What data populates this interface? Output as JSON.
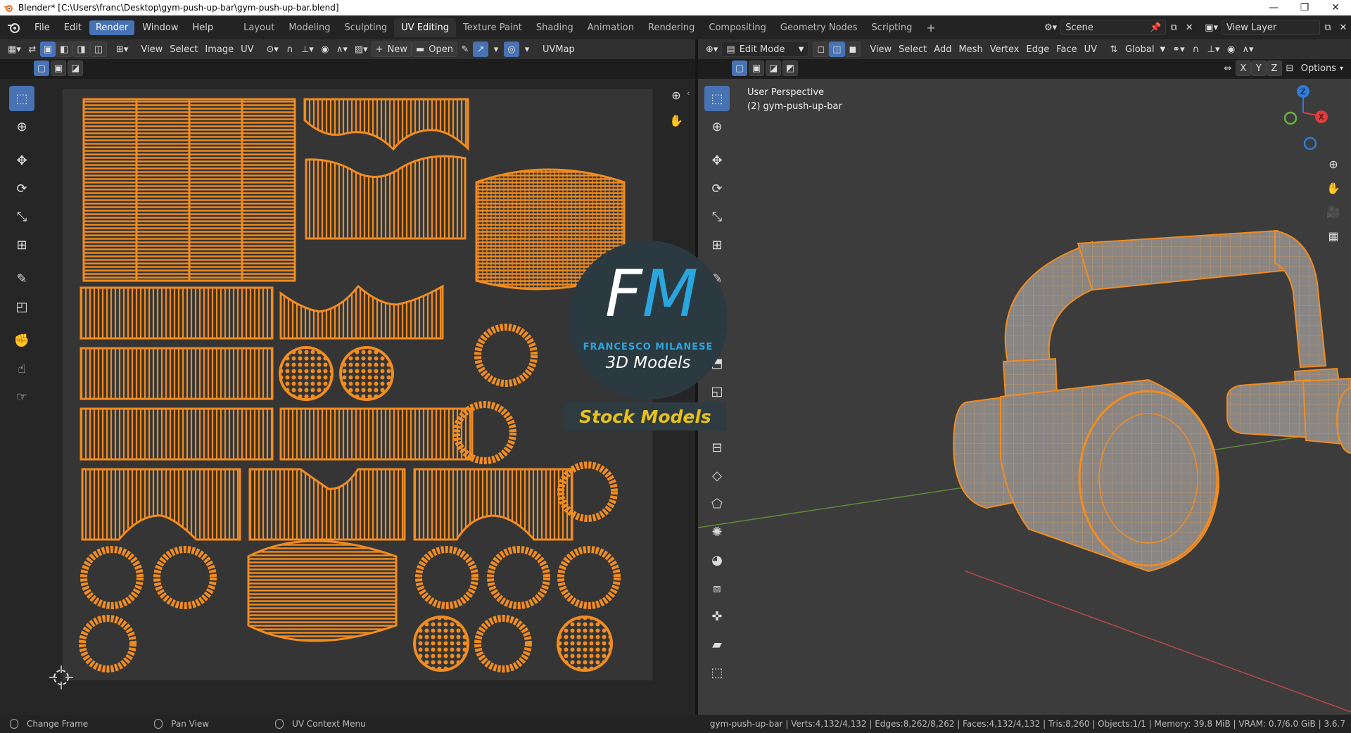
{
  "window": {
    "title": "Blender* [C:\\Users\\franc\\Desktop\\gym-push-up-bar\\gym-push-up-bar.blend]",
    "controls": [
      "—",
      "❐",
      "✕"
    ]
  },
  "menu": [
    "File",
    "Edit",
    "Render",
    "Window",
    "Help"
  ],
  "active_menu": "Render",
  "workspaces": [
    "Layout",
    "Modeling",
    "Sculpting",
    "UV Editing",
    "Texture Paint",
    "Shading",
    "Animation",
    "Rendering",
    "Compositing",
    "Geometry Nodes",
    "Scripting"
  ],
  "active_workspace": "UV Editing",
  "add_workspace": "+",
  "scene": {
    "value": "Scene"
  },
  "view_layer": {
    "value": "View Layer"
  },
  "uv_editor": {
    "menus": [
      "View",
      "Select",
      "Image",
      "UV"
    ],
    "new_label": "New",
    "open_label": "Open",
    "uvmap": "UVMap"
  },
  "viewport": {
    "mode": "Edit Mode",
    "menus": [
      "View",
      "Select",
      "Add",
      "Mesh",
      "Vertex",
      "Edge",
      "Face",
      "UV"
    ],
    "orientation": "Global",
    "axes": [
      "X",
      "Y",
      "Z"
    ],
    "options_label": "Options",
    "perspective": "User Perspective",
    "object_label": "(2) gym-push-up-bar"
  },
  "watermark": {
    "logo_f": "F",
    "logo_m": "M",
    "name": "FRANCESCO MILANESE",
    "subtitle": "3D Models",
    "stock": "Stock Models"
  },
  "statusbar": {
    "hints": [
      "Change Frame",
      "Pan View",
      "UV Context Menu"
    ],
    "stats": "gym-push-up-bar | Verts:4,132/4,132 | Edges:8,262/8,262 | Faces:4,132/4,132 | Tris:8,260 | Objects:1/1 | Memory: 39.8 MiB | VRAM: 0.7/6.0 GiB | 3.6.7"
  },
  "colors": {
    "uv_orange": "#f28c1e",
    "accent_blue": "#4772b3",
    "axis_red": "#e03c3c",
    "axis_green": "#6bb040",
    "axis_blue": "#2f7bd6"
  }
}
